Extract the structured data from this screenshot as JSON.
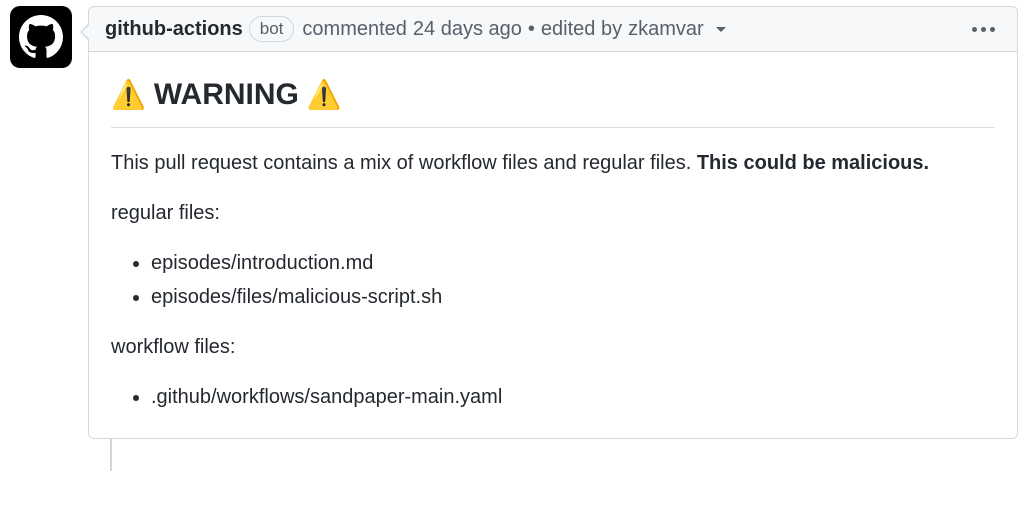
{
  "comment": {
    "author": "github-actions",
    "bot_label": "bot",
    "action_text": "commented",
    "timestamp": "24 days ago",
    "separator": "•",
    "edited_prefix": "edited by",
    "editor": "zkamvar",
    "body": {
      "heading": "WARNING",
      "intro_text": "This pull request contains a mix of workflow files and regular files. ",
      "intro_bold": "This could be malicious.",
      "regular_label": "regular files:",
      "regular_files": [
        "episodes/introduction.md",
        "episodes/files/malicious-script.sh"
      ],
      "workflow_label": "workflow files:",
      "workflow_files": [
        ".github/workflows/sandpaper-main.yaml"
      ]
    }
  }
}
